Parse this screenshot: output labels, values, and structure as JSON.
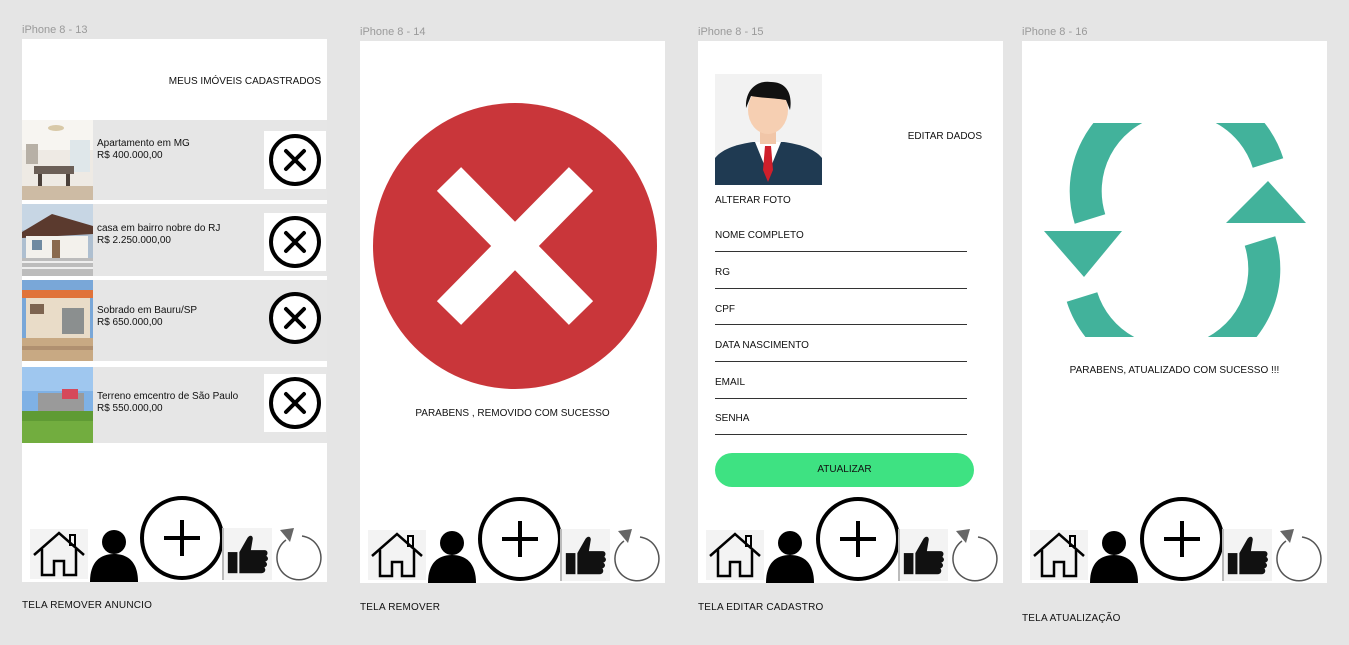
{
  "frames": {
    "f13": {
      "name": "iPhone 8 - 13",
      "caption": "TELA REMOVER ANUNCIO"
    },
    "f14": {
      "name": "iPhone 8 - 14",
      "caption": "TELA REMOVER"
    },
    "f15": {
      "name": "iPhone 8 - 15",
      "caption": "TELA EDITAR CADASTRO"
    },
    "f16": {
      "name": "iPhone 8 - 16",
      "caption": "TELA ATUALIZAÇÃO"
    }
  },
  "screen13": {
    "title": "MEUS IMÓVEIS CADASTRADOS",
    "listings": [
      {
        "name": "Apartamento em MG",
        "price": "R$ 400.000,00"
      },
      {
        "name": "casa em bairro nobre do RJ",
        "price": "R$ 2.250.000,00"
      },
      {
        "name": "Sobrado em Bauru/SP",
        "price": "R$ 650.000,00"
      },
      {
        "name": "Terreno emcentro de São Paulo",
        "price": "R$ 550.000,00"
      }
    ]
  },
  "screen14": {
    "message": "PARABENS , REMOVIDO COM SUCESSO"
  },
  "screen15": {
    "title": "EDITAR DADOS",
    "change_photo": "ALTERAR FOTO",
    "fields": [
      "NOME COMPLETO",
      "RG",
      "CPF",
      "DATA NASCIMENTO",
      "EMAIL",
      "SENHA"
    ],
    "button": "ATUALIZAR"
  },
  "screen16": {
    "message": "PARABENS, ATUALIZADO COM SUCESSO !!!"
  },
  "colors": {
    "danger": "#c9363a",
    "success_button": "#3ee282",
    "refresh": "#42b29b"
  },
  "icons": {
    "nav": [
      "home-icon",
      "user-icon",
      "add-icon",
      "thumbs-up-icon",
      "reload-icon"
    ],
    "remove": "remove-x-icon"
  }
}
